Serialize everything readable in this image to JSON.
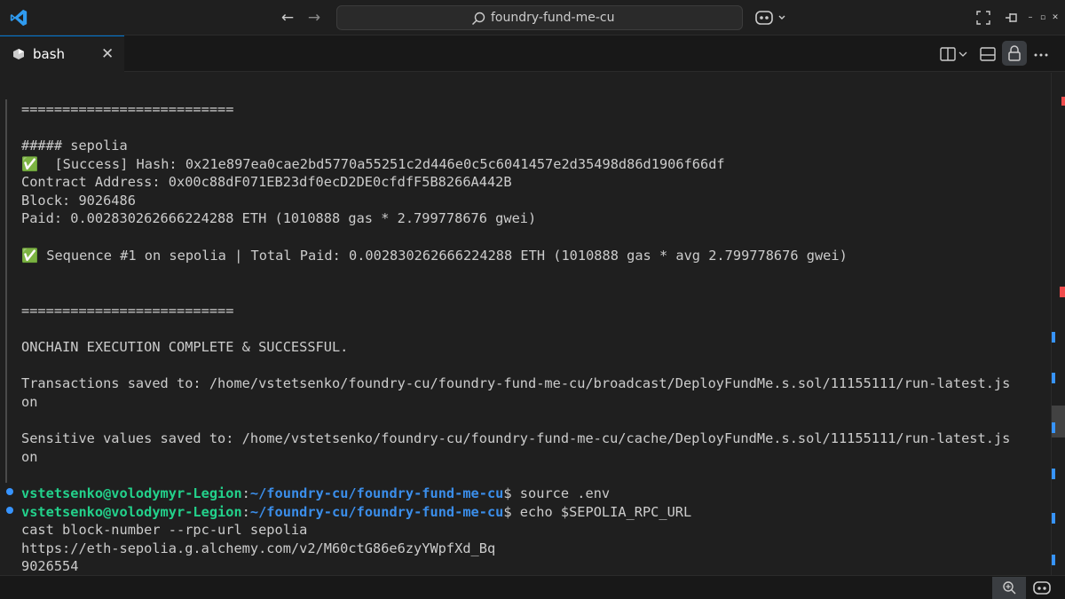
{
  "titlebar": {
    "search_text": "foundry-fund-me-cu"
  },
  "tab": {
    "label": "bash",
    "close_symbol": "✕"
  },
  "terminal": {
    "lines": [
      {
        "text": "=========================="
      },
      {
        "text": "##### sepolia"
      },
      {
        "check": "✅",
        "text": "  [Success] Hash: 0x21e897ea0cae2bd5770a55251c2d446e0c5c6041457e2d35498d86d1906f66df"
      },
      {
        "text": "Contract Address: 0x00c88dF071EB23df0ecD2DE0cfdfF5B8266A442B"
      },
      {
        "text": "Block: 9026486"
      },
      {
        "text": "Paid: 0.002830262666224288 ETH (1010888 gas * 2.799778676 gwei)"
      },
      {
        "check": "✅",
        "text": " Sequence #1 on sepolia | Total Paid: 0.002830262666224288 ETH (1010888 gas * avg 2.799778676 gwei)"
      },
      {
        "text": "=========================="
      },
      {
        "text": "ONCHAIN EXECUTION COMPLETE & SUCCESSFUL."
      },
      {
        "text": "Transactions saved to: /home/vstetsenko/foundry-cu/foundry-fund-me-cu/broadcast/DeployFundMe.s.sol/11155111/run-latest.js"
      },
      {
        "text": "on"
      },
      {
        "text": "Sensitive values saved to: /home/vstetsenko/foundry-cu/foundry-fund-me-cu/cache/DeployFundMe.s.sol/11155111/run-latest.js"
      },
      {
        "text": "on"
      }
    ],
    "prompts": [
      {
        "user": "vstetsenko@volodymyr-Legion",
        "sep": ":",
        "path": "~/foundry-cu/foundry-fund-me-cu",
        "cmd": "$ source .env"
      },
      {
        "user": "vstetsenko@volodymyr-Legion",
        "sep": ":",
        "path": "~/foundry-cu/foundry-fund-me-cu",
        "cmd": "$ echo $SEPOLIA_RPC_URL"
      }
    ],
    "output": [
      "cast block-number --rpc-url sepolia",
      "https://eth-sepolia.g.alchemy.com/v2/M60ctG86e6zyYWpfXd_Bq",
      "9026554"
    ]
  },
  "colors": {
    "prompt_user": "#23d18b",
    "prompt_path": "#3b8eea",
    "accent": "#0078d4"
  }
}
